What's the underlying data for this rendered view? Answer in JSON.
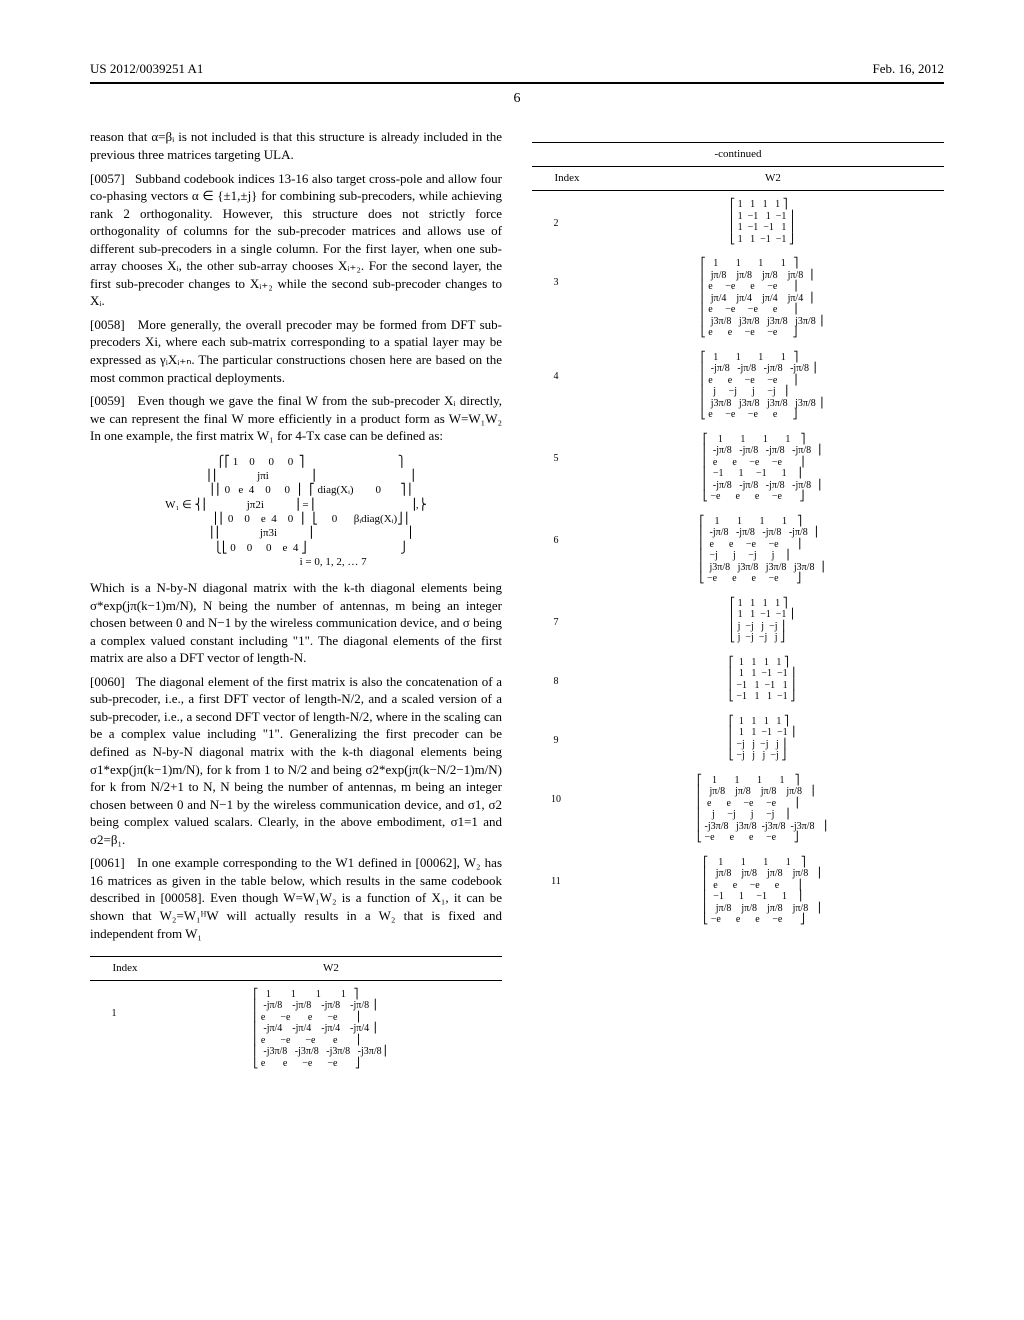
{
  "header": {
    "left": "US 2012/0039251 A1",
    "right": "Feb. 16, 2012"
  },
  "page_number": "6",
  "col1": {
    "p_intro": "reason that α=βᵢ is not included is that this structure is already included in the previous three matrices targeting ULA.",
    "p0057_num": "[0057]",
    "p0057": "Subband codebook indices 13-16 also target cross-pole and allow four co-phasing vectors α ∈ {±1,±j} for combining sub-precoders, while achieving rank 2 orthogonality. However, this structure does not strictly force orthogonality of columns for the sub-precoder matrices and allows use of different sub-precoders in a single column. For the first layer, when one sub-array chooses Xᵢ, the other sub-array chooses Xᵢ₊₂. For the second layer, the first sub-precoder changes to Xᵢ₊₂ while the second sub-precoder changes to Xᵢ.",
    "p0058_num": "[0058]",
    "p0058": "More generally, the overall precoder may be formed from DFT sub-precoders Xi, where each sub-matrix corresponding to a spatial layer may be expressed as γᵢXᵢ₊ₙ. The particular constructions chosen here are based on the most common practical deployments.",
    "p0059_num": "[0059]",
    "p0059": "Even though we gave the final W from the sub-precoder Xᵢ directly, we can represent the final W more efficiently in a product form as W=W₁W₂ In one example, the first matrix W₁ for 4-Tx case can be defined as:",
    "w1_matrix": "           ⎧⎡ 1    0     0     0  ⎤                                  ⎫\n           ⎪⎢              jπi               ⎥                                  ⎪\n           ⎪⎢ 0   e  4    0     0  ⎥   ⎡ diag(Xᵢ)        0       ⎤⎪\nW₁ ∈ ⎨⎢              jπ2i           ⎥ = ⎢                                  ⎥,⎬\n           ⎪⎢ 0    0    e  4    0  ⎥   ⎣     0      βᵢdiag(Xᵢ)⎦⎪\n           ⎪⎢              jπ3i           ⎥                                  ⎪\n           ⎩⎣ 0    0     0    e  4 ⎦                                  ⎭\n                           i = 0, 1, 2, … 7",
    "p_mid": "Which is a N-by-N diagonal matrix with the k-th diagonal elements being σ*exp(jπ(k−1)m/N), N being the number of antennas, m being an integer chosen between 0 and N−1 by the wireless communication device, and σ being a complex valued constant including \"1\". The diagonal elements of the first matrix are also a DFT vector of length-N.",
    "p0060_num": "[0060]",
    "p0060": "The diagonal element of the first matrix is also the concatenation of a sub-precoder, i.e., a first DFT vector of length-N/2, and a scaled version of a sub-precoder, i.e., a second DFT vector of length-N/2, where in the scaling can be a complex value including \"1\". Generalizing the first precoder can be defined as N-by-N diagonal matrix with the k-th diagonal elements being σ1*exp(jπ(k−1)m/N), for k from 1 to N/2 and being σ2*exp(jπ(k−N/2−1)m/N) for k from N/2+1 to N, N being the number of antennas, m being an integer chosen between 0 and N−1 by the wireless communication device, and σ1, σ2 being complex valued scalars. Clearly, in the above embodiment, σ1=1 and σ2=β₁.",
    "p0061_num": "[0061]",
    "p0061": "In one example corresponding to the W1 defined in [00062], W₂ has 16 matrices as given in the table below, which results in the same codebook described in [00058]. Even though W=W₁W₂ is a function of X₁, it can be shown that W₂=W₁ᴴW will actually results in a W₂ that is fixed and independent from W₁",
    "tbl": {
      "h1": "Index",
      "h2": "W2",
      "rows": [
        {
          "idx": "1",
          "m": "⎡   1        1        1        1   ⎤\n⎢  -jπ/8    -jπ/8    -jπ/8    -jπ/8 ⎥\n⎢ e      −e       e      −e       ⎥\n⎢  -jπ/4    -jπ/4    -jπ/4    -jπ/4 ⎥\n⎢ e      −e      −e       e       ⎥\n⎢  -j3π/8   -j3π/8   -j3π/8   -j3π/8⎥\n⎣ e       e      −e      −e       ⎦"
        }
      ]
    }
  },
  "col2": {
    "continued": "-continued",
    "tbl": {
      "h1": "Index",
      "h2": "W2",
      "rows": [
        {
          "idx": "2",
          "m": "⎡ 1   1   1   1 ⎤\n⎢ 1  −1   1  −1 ⎥\n⎢ 1  −1  −1   1 ⎥\n⎣ 1   1  −1  −1 ⎦"
        },
        {
          "idx": "3",
          "m": "⎡   1       1       1       1   ⎤\n⎢  jπ/8    jπ/8    jπ/8    jπ/8  ⎥\n⎢ e     −e      e     −e      ⎥\n⎢  jπ/4    jπ/4    jπ/4    jπ/4  ⎥\n⎢ e     −e     −e      e      ⎥\n⎢  j3π/8   j3π/8   j3π/8   j3π/8 ⎥\n⎣ e      e     −e     −e      ⎦"
        },
        {
          "idx": "4",
          "m": "⎡   1       1       1       1   ⎤\n⎢  -jπ/8   -jπ/8   -jπ/8   -jπ/8 ⎥\n⎢ e      e     −e     −e      ⎥\n⎢   j     −j      j     −j   ⎥\n⎢  j3π/8   j3π/8   j3π/8   j3π/8 ⎥\n⎣ e     −e     −e      e      ⎦"
        },
        {
          "idx": "5",
          "m": "⎡    1       1       1       1    ⎤\n⎢  -jπ/8   -jπ/8   -jπ/8   -jπ/8  ⎥\n⎢  e      e     −e     −e       ⎥\n⎢  −1      1     −1      1    ⎥\n⎢  -jπ/8   -jπ/8   -jπ/8   -jπ/8  ⎥\n⎣ −e      e      e     −e       ⎦"
        },
        {
          "idx": "6",
          "m": "⎡    1       1       1       1    ⎤\n⎢  -jπ/8   -jπ/8   -jπ/8   -jπ/8  ⎥\n⎢  e      e     −e     −e       ⎥\n⎢  −j      j     −j      j    ⎥\n⎢  j3π/8   j3π/8   j3π/8   j3π/8  ⎥\n⎣ −e      e      e     −e       ⎦"
        },
        {
          "idx": "7",
          "m": "⎡ 1   1   1   1 ⎤\n⎢ 1   1  −1  −1 ⎥\n⎢ j  −j   j  −j ⎥\n⎣ j  −j  −j   j ⎦"
        },
        {
          "idx": "8",
          "m": "⎡  1   1   1   1 ⎤\n⎢  1   1  −1  −1 ⎥\n⎢ −1   1  −1   1 ⎥\n⎣ −1   1   1  −1 ⎦"
        },
        {
          "idx": "9",
          "m": "⎡  1   1   1   1 ⎤\n⎢  1   1  −1  −1 ⎥\n⎢ −j   j  −j   j ⎥\n⎣ −j   j   j  −j ⎦"
        },
        {
          "idx": "10",
          "m": "⎡    1       1       1       1    ⎤\n⎢   jπ/8    jπ/8    jπ/8    jπ/8   ⎥\n⎢  e      e     −e     −e       ⎥\n⎢    j     −j      j     −j    ⎥\n⎢ -j3π/8   j3π/8  -j3π/8  -j3π/8   ⎥\n⎣ −e      e      e     −e       ⎦"
        },
        {
          "idx": "11",
          "m": "⎡    1       1       1       1    ⎤\n⎢   jπ/8    jπ/8    jπ/8    jπ/8   ⎥\n⎢  e      e     −e      e       ⎥\n⎢  −1      1     −1      1    ⎥\n⎢   jπ/8    jπ/8    jπ/8    jπ/8   ⎥\n⎣ −e      e      e     −e       ⎦"
        }
      ]
    }
  }
}
